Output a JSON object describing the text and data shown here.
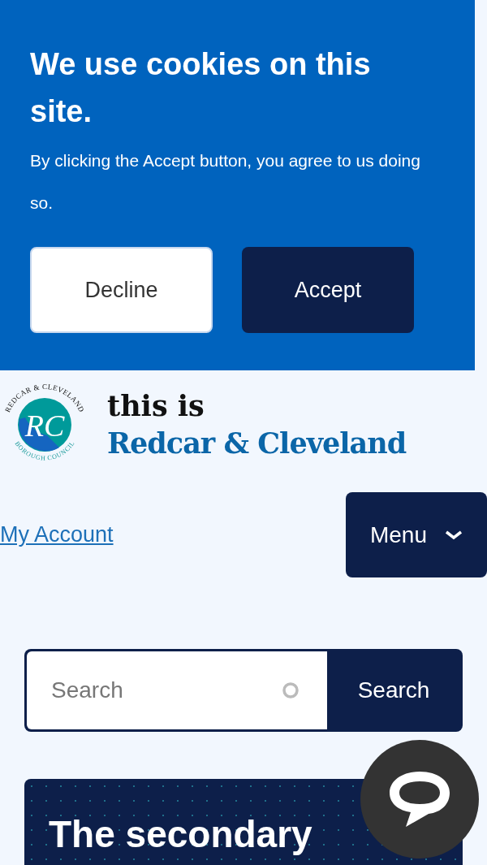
{
  "cookie_banner": {
    "title": "We use cookies on this site.",
    "message": "By clicking the Accept button, you agree to us doing so.",
    "buttons": [
      {
        "label": "Decline",
        "kind": "secondary"
      },
      {
        "label": "Accept",
        "kind": "primary"
      }
    ]
  },
  "logo": {
    "ring_top": "REDCAR & CLEVELAND",
    "ring_bottom": "BOROUGH COUNCIL",
    "monogram": "RC",
    "tagline": "this is",
    "name": "Redcar & Cleveland"
  },
  "nav": {
    "account_link": "My Account",
    "menu_button": "Menu"
  },
  "search": {
    "placeholder": "Search",
    "button": "Search"
  },
  "hero": {
    "heading": "The secondary"
  }
}
